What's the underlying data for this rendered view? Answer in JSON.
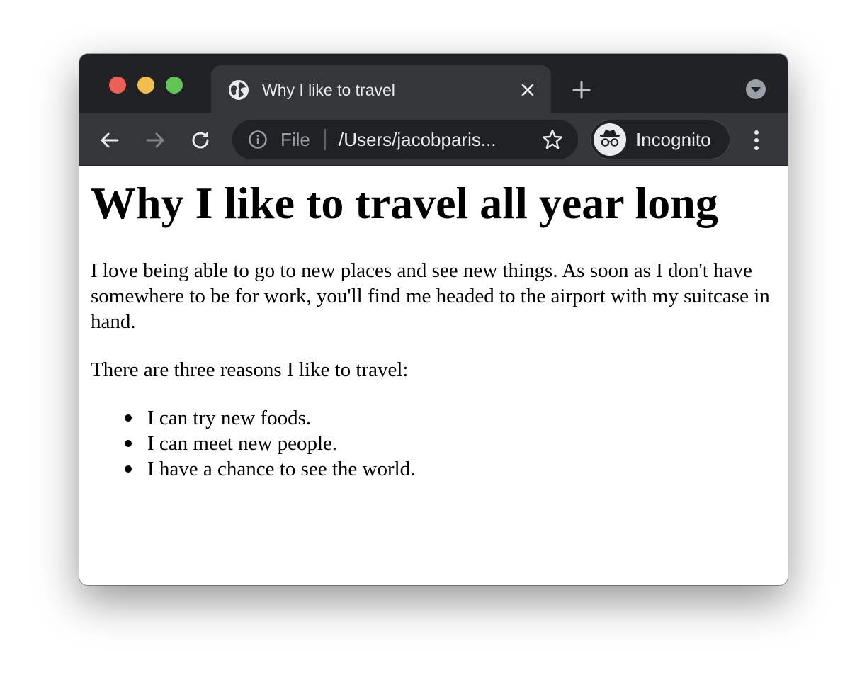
{
  "tab": {
    "title": "Why I like to travel",
    "icon": "globe-icon"
  },
  "toolbar": {
    "scheme_label": "File",
    "url": "/Users/jacobparis...",
    "profile_label": "Incognito"
  },
  "page": {
    "heading": "Why I like to travel all year long",
    "intro": "I love being able to go to new places and see new things. As soon as I don't have somewhere to be for work, you'll find me headed to the airport with my suitcase in hand.",
    "reasons_intro": "There are three reasons I like to travel:",
    "reasons": [
      "I can try new foods.",
      "I can meet new people.",
      "I have a chance to see the world."
    ]
  },
  "colors": {
    "titlebar": "#202124",
    "toolbar": "#35363a",
    "close_light": "#ec5f56",
    "minimize_light": "#f4be4f",
    "maximize_light": "#61c454"
  }
}
